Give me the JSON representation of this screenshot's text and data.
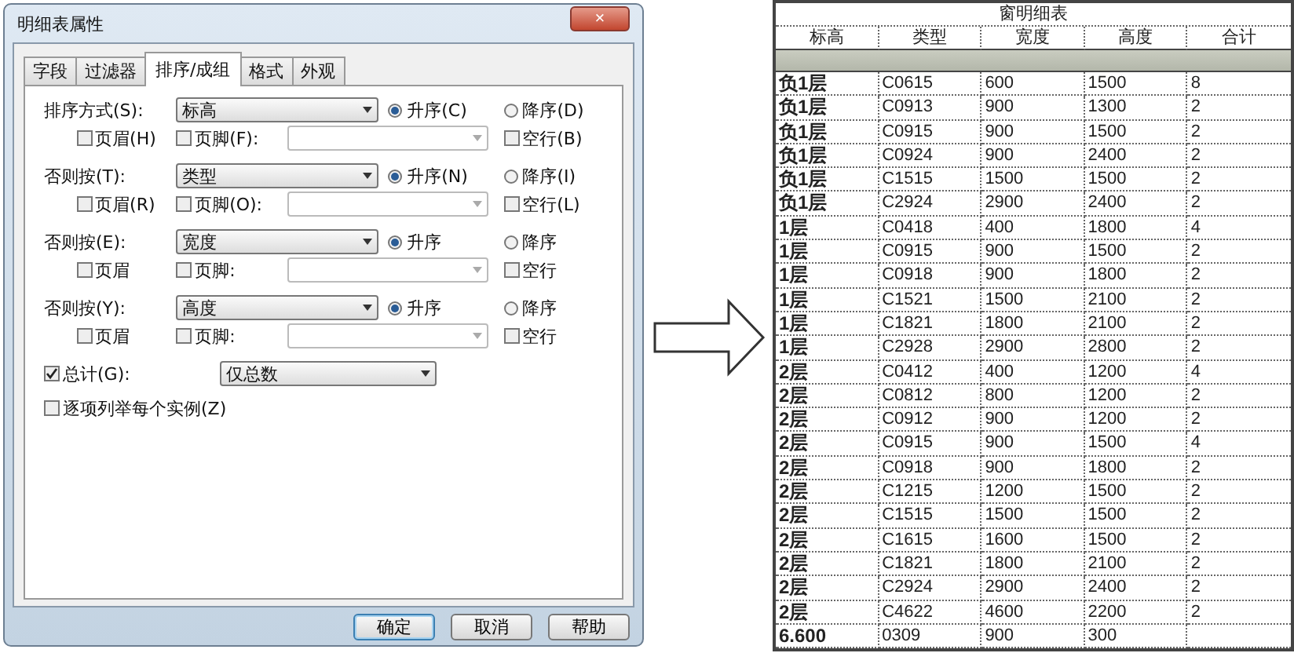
{
  "dialog": {
    "title": "明细表属性",
    "close": "×",
    "tabs": [
      {
        "label": "字段",
        "selected": false
      },
      {
        "label": "过滤器",
        "selected": false
      },
      {
        "label": "排序/成组",
        "selected": true
      },
      {
        "label": "格式",
        "selected": false
      },
      {
        "label": "外观",
        "selected": false
      }
    ],
    "sort_groups": [
      {
        "label": "排序方式(S):",
        "field": "标高",
        "order": [
          {
            "label": "升序(C)",
            "selected": true
          },
          {
            "label": "降序(D)",
            "selected": false
          }
        ],
        "header": {
          "label": "页眉(H)",
          "checked": false
        },
        "footer": {
          "label": "页脚(F):",
          "checked": false
        },
        "blank_line": {
          "label": "空行(B)",
          "checked": false
        }
      },
      {
        "label": "否则按(T):",
        "field": "类型",
        "order": [
          {
            "label": "升序(N)",
            "selected": true
          },
          {
            "label": "降序(I)",
            "selected": false
          }
        ],
        "header": {
          "label": "页眉(R)",
          "checked": false
        },
        "footer": {
          "label": "页脚(O):",
          "checked": false
        },
        "blank_line": {
          "label": "空行(L)",
          "checked": false
        }
      },
      {
        "label": "否则按(E):",
        "field": "宽度",
        "order": [
          {
            "label": "升序",
            "selected": true
          },
          {
            "label": "降序",
            "selected": false
          }
        ],
        "header": {
          "label": "页眉",
          "checked": false
        },
        "footer": {
          "label": "页脚:",
          "checked": false
        },
        "blank_line": {
          "label": "空行",
          "checked": false
        }
      },
      {
        "label": "否则按(Y):",
        "field": "高度",
        "order": [
          {
            "label": "升序",
            "selected": true
          },
          {
            "label": "降序",
            "selected": false
          }
        ],
        "header": {
          "label": "页眉",
          "checked": false
        },
        "footer": {
          "label": "页脚:",
          "checked": false
        },
        "blank_line": {
          "label": "空行",
          "checked": false
        }
      }
    ],
    "grand_total": {
      "label": "总计(G):",
      "checked": true,
      "value": "仅总数"
    },
    "itemize": {
      "label": "逐项列举每个实例(Z)",
      "checked": false
    },
    "buttons": [
      "确定",
      "取消",
      "帮助"
    ]
  },
  "schedule": {
    "title": "窗明细表",
    "columns": [
      "标高",
      "类型",
      "宽度",
      "高度",
      "合计"
    ],
    "rows": [
      [
        "负1层",
        "C0615",
        "600",
        "1500",
        "8"
      ],
      [
        "负1层",
        "C0913",
        "900",
        "1300",
        "2"
      ],
      [
        "负1层",
        "C0915",
        "900",
        "1500",
        "2"
      ],
      [
        "负1层",
        "C0924",
        "900",
        "2400",
        "2"
      ],
      [
        "负1层",
        "C1515",
        "1500",
        "1500",
        "2"
      ],
      [
        "负1层",
        "C2924",
        "2900",
        "2400",
        "2"
      ],
      [
        "1层",
        "C0418",
        "400",
        "1800",
        "4"
      ],
      [
        "1层",
        "C0915",
        "900",
        "1500",
        "2"
      ],
      [
        "1层",
        "C0918",
        "900",
        "1800",
        "2"
      ],
      [
        "1层",
        "C1521",
        "1500",
        "2100",
        "2"
      ],
      [
        "1层",
        "C1821",
        "1800",
        "2100",
        "2"
      ],
      [
        "1层",
        "C2928",
        "2900",
        "2800",
        "2"
      ],
      [
        "2层",
        "C0412",
        "400",
        "1200",
        "4"
      ],
      [
        "2层",
        "C0812",
        "800",
        "1200",
        "2"
      ],
      [
        "2层",
        "C0912",
        "900",
        "1200",
        "2"
      ],
      [
        "2层",
        "C0915",
        "900",
        "1500",
        "4"
      ],
      [
        "2层",
        "C0918",
        "900",
        "1800",
        "2"
      ],
      [
        "2层",
        "C1215",
        "1200",
        "1500",
        "2"
      ],
      [
        "2层",
        "C1515",
        "1500",
        "1500",
        "2"
      ],
      [
        "2层",
        "C1615",
        "1600",
        "1500",
        "2"
      ],
      [
        "2层",
        "C1821",
        "1800",
        "2100",
        "2"
      ],
      [
        "2层",
        "C2924",
        "2900",
        "2400",
        "2"
      ],
      [
        "2层",
        "C4622",
        "4600",
        "2200",
        "2"
      ],
      [
        "6.600",
        "0309",
        "900",
        "300"
      ]
    ]
  }
}
